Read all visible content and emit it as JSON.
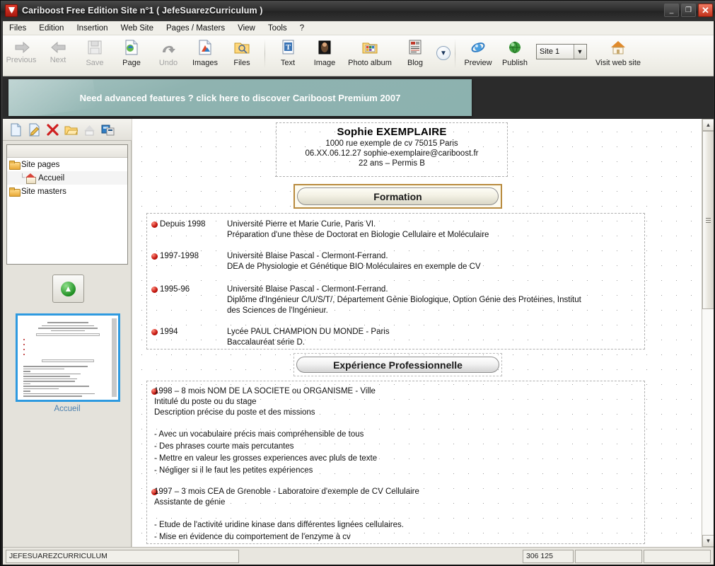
{
  "window": {
    "title": "Cariboost Free Edition Site n°1 ( JefeSuarezCurriculum )",
    "logo_icon": "cariboost-logo-icon",
    "minimize_label": "_",
    "maximize_label": "❐",
    "close_label": "✕"
  },
  "menubar": {
    "items": [
      {
        "label": "Files"
      },
      {
        "label": "Edition"
      },
      {
        "label": "Insertion"
      },
      {
        "label": "Web Site"
      },
      {
        "label": "Pages / Masters"
      },
      {
        "label": "View"
      },
      {
        "label": "Tools"
      },
      {
        "label": "?"
      }
    ]
  },
  "toolbar": {
    "buttons": [
      {
        "label": "Previous",
        "icon": "arrow-left-icon",
        "disabled": true
      },
      {
        "label": "Next",
        "icon": "arrow-right-icon",
        "disabled": true
      },
      {
        "label": "Save",
        "icon": "floppy-disk-icon",
        "disabled": true
      },
      {
        "label": "Page",
        "icon": "page-icon",
        "disabled": false
      },
      {
        "label": "Undo",
        "icon": "undo-arrow-icon",
        "disabled": true
      },
      {
        "label": "Images",
        "icon": "images-icon",
        "disabled": false
      },
      {
        "label": "Files",
        "icon": "files-folder-icon",
        "disabled": false
      },
      {
        "label": "Text",
        "icon": "text-t-icon",
        "disabled": false
      },
      {
        "label": "Image",
        "icon": "photo-icon",
        "disabled": false
      },
      {
        "label": "Photo album",
        "icon": "photo-album-icon",
        "disabled": false
      },
      {
        "label": "Blog",
        "icon": "blog-icon",
        "disabled": false
      }
    ],
    "expand_icon": "chevron-double-down-icon",
    "right_buttons": [
      {
        "label": "Preview",
        "icon": "browser-preview-icon"
      },
      {
        "label": "Publish",
        "icon": "globe-publish-icon"
      }
    ],
    "site_select": {
      "value": "Site 1",
      "caret_icon": "chevron-down-icon"
    },
    "visit": {
      "label": "Visit web site",
      "icon": "home-house-icon"
    }
  },
  "promo": {
    "text": "Need advanced features ? click here to discover Cariboost Premium 2007",
    "bg_color": "#8fb3b0"
  },
  "left_pane": {
    "tool_icons": [
      {
        "name": "new-page-icon"
      },
      {
        "name": "edit-pencil-icon"
      },
      {
        "name": "delete-x-icon"
      },
      {
        "name": "open-folder-icon"
      },
      {
        "name": "home-page-icon"
      },
      {
        "name": "duplicate-page-icon"
      }
    ],
    "tree": [
      {
        "label": "Site pages",
        "icon": "folder-icon",
        "level": 0,
        "selected": false
      },
      {
        "label": "Accueil",
        "icon": "home-page-icon",
        "level": 1,
        "selected": true
      },
      {
        "label": "Site masters",
        "icon": "folder-icon",
        "level": 0,
        "selected": false
      }
    ],
    "add_button": {
      "icon": "add-green-arrow-icon"
    },
    "thumbnail_caption": "Accueil"
  },
  "document": {
    "header": {
      "name": "Sophie EXEMPLAIRE",
      "address": "1000 rue exemple de cv 75015 Paris",
      "contact": "06.XX.06.12.27  sophie-exemplaire@cariboost.fr",
      "extra": "22 ans – Permis B"
    },
    "sections": [
      {
        "title": "Formation",
        "selected": true
      },
      {
        "title": "Expérience  Professionnelle",
        "selected": false
      }
    ],
    "formation": [
      {
        "year": "Depuis 1998",
        "lines": [
          "Université Pierre et Marie Curie, Paris VI.",
          "Préparation d'une thèse de Doctorat en Biologie Cellulaire et Moléculaire"
        ]
      },
      {
        "year": "1997-1998",
        "lines": [
          "Université Blaise Pascal - Clermont-Ferrand.",
          "DEA de Physiologie et Génétique BIO Moléculaires en exemple de CV"
        ]
      },
      {
        "year": "1995-96",
        "lines": [
          "Université Blaise Pascal - Clermont-Ferrand.",
          "Diplôme d'Ingénieur C/U/S/T/, Département Génie Biologique, Option Génie des Protéines, Institut",
          "des Sciences de l'Ingénieur."
        ]
      },
      {
        "year": "1994",
        "lines": [
          "Lycée PAUL CHAMPION DU MONDE - Paris",
          "Baccalauréat série D."
        ]
      }
    ],
    "experience": [
      "1998 – 8 mois     NOM DE LA SOCIETE ou ORGANISME - Ville",
      "Intitulé du poste ou du stage",
      "Description précise du poste et des missions",
      "",
      "- Avec un vocabulaire précis mais compréhensible de tous",
      "- Des phrases courte mais percutantes",
      "- Mettre en valeur les grosses experiences avec pluls de texte",
      "- Négliger si il le faut les petites expériences",
      "",
      "1997 – 3 mois     CEA de Grenoble - Laboratoire d'exemple de CV Cellulaire",
      "Assistante de génie",
      "",
      "- Etude de l'activité uridine kinase dans différentes lignées cellulaires.",
      "- Mise en évidence du comportement de l'enzyme à cv"
    ]
  },
  "scrollbar": {
    "up_icon": "chevron-up-icon",
    "down_icon": "chevron-down-icon",
    "grip_icon": "grip-lines-icon"
  },
  "statusbar": {
    "site_name": "JEFESUAREZCURRICULUM",
    "coordinates": "306 125",
    "field_a": "",
    "field_b": ""
  }
}
